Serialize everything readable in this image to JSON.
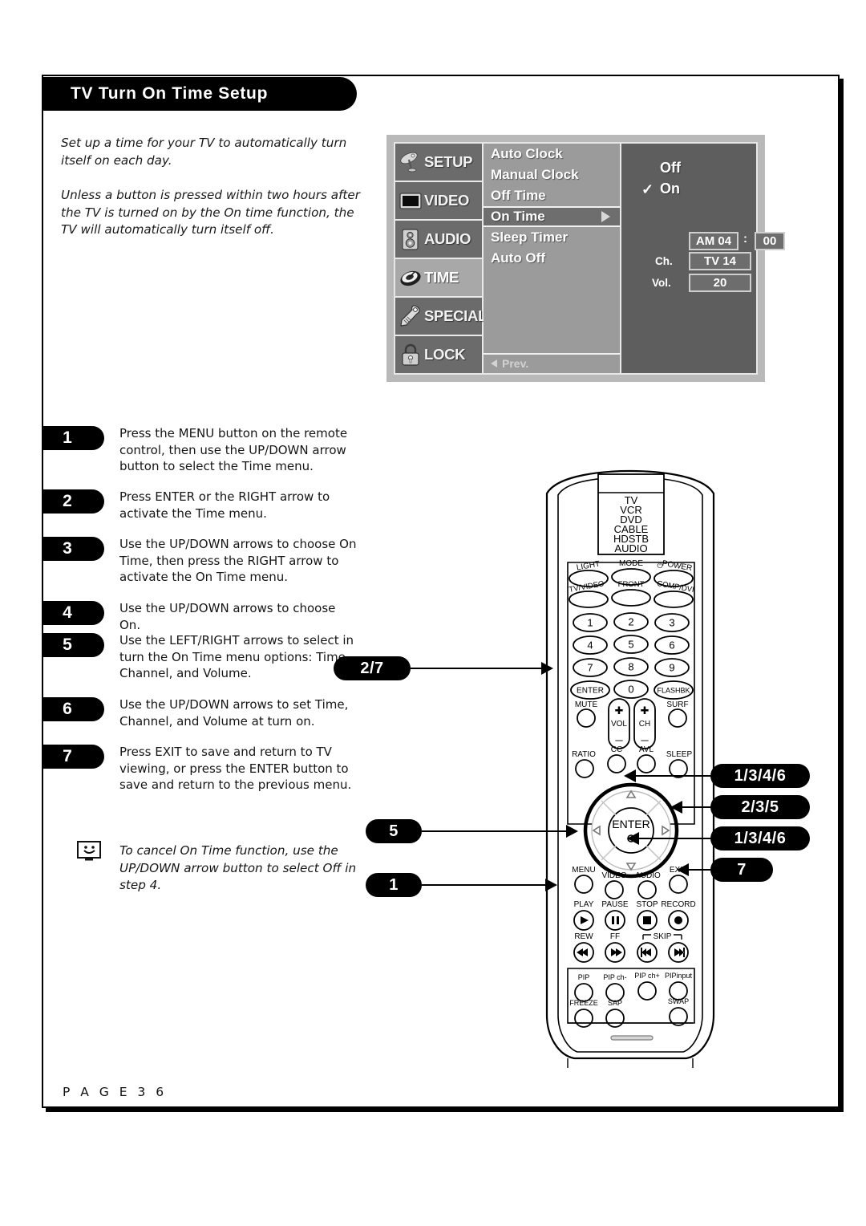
{
  "page": {
    "title": "TV Turn On Time Setup",
    "page_number": "P A G E   3 6"
  },
  "intro": {
    "paragraph1": "Set up a time for your TV to automatically turn itself on each day.",
    "paragraph2": "Unless a button is pressed within two hours after the TV is turned on by the On time function, the TV will automatically turn itself off."
  },
  "osd": {
    "nav": [
      {
        "label": "SETUP",
        "icon": "satellite-dish-icon",
        "selected": false
      },
      {
        "label": "VIDEO",
        "icon": "monitor-icon",
        "selected": false
      },
      {
        "label": "AUDIO",
        "icon": "speaker-icon",
        "selected": false
      },
      {
        "label": "TIME",
        "icon": "clock-disc-icon",
        "selected": true
      },
      {
        "label": "SPECIAL",
        "icon": "brush-tag-icon",
        "selected": false
      },
      {
        "label": "LOCK",
        "icon": "padlock-icon",
        "selected": false
      }
    ],
    "menu_items": [
      {
        "label": "Auto Clock",
        "selected": false
      },
      {
        "label": "Manual Clock",
        "selected": false
      },
      {
        "label": "Off Time",
        "selected": false
      },
      {
        "label": "On Time",
        "selected": true
      },
      {
        "label": "Sleep Timer",
        "selected": false
      },
      {
        "label": "Auto Off",
        "selected": false
      }
    ],
    "prev_label": "Prev.",
    "detail": {
      "option_off": "Off",
      "option_on": "On",
      "checkmark": "✓",
      "selected_option": "On",
      "time_ampm_hour": "AM 04",
      "time_separator": ":",
      "time_minute": "00",
      "channel_label": "Ch.",
      "channel_value": "TV 14",
      "volume_label": "Vol.",
      "volume_value": "20"
    }
  },
  "steps": [
    {
      "num": "1",
      "text": "Press the MENU button on the remote control, then use the UP/DOWN arrow button to select the Time menu."
    },
    {
      "num": "2",
      "text": "Press ENTER or the RIGHT arrow to activate the Time menu."
    },
    {
      "num": "3",
      "text": "Use the UP/DOWN arrows to choose On Time, then press the RIGHT arrow to activate the On Time menu."
    },
    {
      "num": "4",
      "text": "Use the UP/DOWN arrows to choose On."
    },
    {
      "num": "5",
      "text": "Use the LEFT/RIGHT arrows to select in turn the On Time menu options: Time, Channel, and Volume."
    },
    {
      "num": "6",
      "text": "Use the UP/DOWN arrows to set Time, Channel, and Volume at turn on."
    },
    {
      "num": "7",
      "text": "Press EXIT to save and return to TV viewing, or press the ENTER button to save and return to the previous menu."
    }
  ],
  "note": {
    "icon": "tv-smiley-icon",
    "text": "To cancel On Time function, use the UP/DOWN arrow button to select Off in step 4."
  },
  "remote": {
    "mode_list": [
      "TV",
      "VCR",
      "DVD",
      "CABLE",
      "HDSTB",
      "AUDIO"
    ],
    "row_light": [
      "LIGHT",
      "MODE",
      "POWER"
    ],
    "row_input": [
      "TV/VIDEO",
      "FRONT",
      "COMP/DVI"
    ],
    "keypad": [
      "1",
      "2",
      "3",
      "4",
      "5",
      "6",
      "7",
      "8",
      "9",
      "ENTER",
      "0",
      "FLASHBK"
    ],
    "row_mute": [
      "MUTE",
      "VOL",
      "CH",
      "SURF"
    ],
    "row_ratio": [
      "RATIO",
      "CC",
      "AVL",
      "SLEEP"
    ],
    "dpad_center": "ENTER",
    "row_menu": [
      "MENU",
      "VIDEO",
      "AUDIO",
      "EXIT"
    ],
    "row_play": [
      "PLAY",
      "PAUSE",
      "STOP",
      "RECORD"
    ],
    "row_rew": [
      "REW",
      "FF",
      "SKIP"
    ],
    "row_pip": [
      "PIP",
      "PIP ch-",
      "PIP ch+",
      "PIPinput"
    ],
    "row_freeze": [
      "FREEZE",
      "SAP",
      "SWAP"
    ],
    "callouts": {
      "enter_left": "2/7",
      "dpad_left": "5",
      "menu_left": "1",
      "dpad_up_right": "1/3/4/6",
      "dpad_right_right": "2/3/5",
      "dpad_down_right": "1/3/4/6",
      "exit_right": "7"
    }
  }
}
